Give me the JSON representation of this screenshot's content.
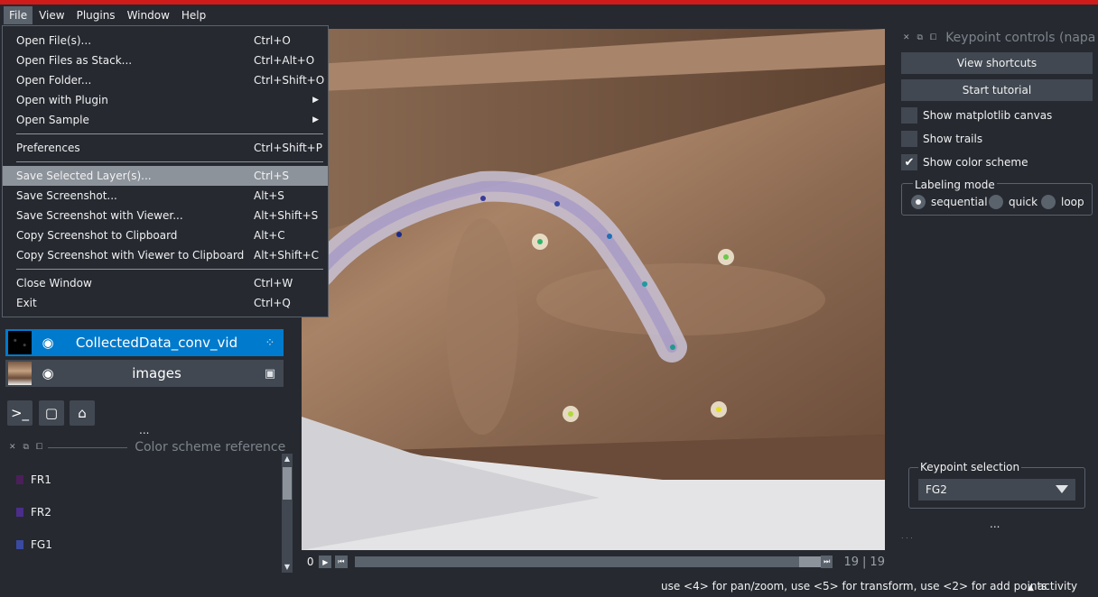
{
  "menubar": {
    "items": [
      "File",
      "View",
      "Plugins",
      "Window",
      "Help"
    ],
    "active": "File"
  },
  "file_menu": {
    "items": [
      {
        "label": "Open File(s)...",
        "shortcut": "Ctrl+O"
      },
      {
        "label": "Open Files as Stack...",
        "shortcut": "Ctrl+Alt+O"
      },
      {
        "label": "Open Folder...",
        "shortcut": "Ctrl+Shift+O"
      },
      {
        "label": "Open with Plugin",
        "shortcut": "",
        "submenu": true
      },
      {
        "label": "Open Sample",
        "shortcut": "",
        "submenu": true
      },
      {
        "label": "Preferences",
        "shortcut": "Ctrl+Shift+P"
      },
      {
        "label": "Save Selected Layer(s)...",
        "shortcut": "Ctrl+S",
        "highlighted": true
      },
      {
        "label": "Save Screenshot...",
        "shortcut": "Alt+S"
      },
      {
        "label": "Save Screenshot with Viewer...",
        "shortcut": "Alt+Shift+S"
      },
      {
        "label": "Copy Screenshot to Clipboard",
        "shortcut": "Alt+C"
      },
      {
        "label": "Copy Screenshot with Viewer to Clipboard",
        "shortcut": "Alt+Shift+C"
      },
      {
        "label": "Close Window",
        "shortcut": "Ctrl+W"
      },
      {
        "label": "Exit",
        "shortcut": "Ctrl+Q"
      }
    ]
  },
  "layers": [
    {
      "name": "CollectedData_conv_vid",
      "type_icon": "points-icon",
      "selected": true
    },
    {
      "name": "images",
      "type_icon": "image-icon",
      "selected": false
    }
  ],
  "layer_toolbar": {
    "buttons": [
      "console-icon",
      "square-icon",
      "home-icon"
    ],
    "more": "..."
  },
  "color_scheme_dock": {
    "title": "Color scheme reference",
    "items": [
      {
        "label": "FR1",
        "color": "#4b1f5a"
      },
      {
        "label": "FR2",
        "color": "#4b2e8a"
      },
      {
        "label": "FG1",
        "color": "#3a4aa0"
      }
    ]
  },
  "dims": {
    "start_label": "0",
    "current": "19",
    "total": "19",
    "frame_fraction": 1.0
  },
  "keypoint_controls": {
    "title": "Keypoint controls (napa",
    "view_shortcuts": "View shortcuts",
    "start_tutorial": "Start tutorial",
    "checkboxes": [
      {
        "label": "Show matplotlib canvas",
        "checked": false
      },
      {
        "label": "Show trails",
        "checked": false
      },
      {
        "label": "Show color scheme",
        "checked": true
      }
    ],
    "labeling_mode": {
      "title": "Labeling mode",
      "options": [
        "sequential",
        "quick",
        "loop"
      ],
      "selected": "sequential"
    },
    "keypoint_selection": {
      "title": "Keypoint selection",
      "value": "FG2"
    },
    "more": "...",
    "corner_dots": ". . ."
  },
  "status": {
    "message": "use <4> for pan/zoom, use <5> for transform, use <2> for add points",
    "activity": "activity",
    "activity_icon": "caret-up-icon"
  },
  "colors": {
    "accent": "#007acc",
    "topbar": "#d01b1b",
    "background": "#262930"
  }
}
